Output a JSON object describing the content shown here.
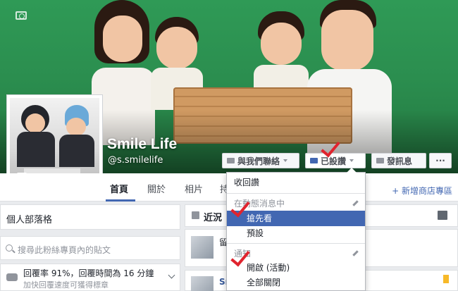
{
  "page": {
    "name": "Smile Life",
    "handle": "@s.smilelife"
  },
  "cover_buttons": {
    "contact": "與我們聯絡",
    "following": "已設讚",
    "message": "發訊息",
    "more": "···"
  },
  "nav": {
    "tabs": [
      "首頁",
      "關於",
      "相片",
      "持"
    ],
    "add_shop": "+ 新增商店專區"
  },
  "left": {
    "blog": "個人部落格",
    "search_placeholder": "搜尋此粉絲專頁內的貼文",
    "response_line1": "回覆率 91%，回覆時間為 16 分鐘",
    "response_line2": "加快回覆速度可獲得標章"
  },
  "right": {
    "recent": "近況",
    "post1_text": "留",
    "post2_text": "Sm"
  },
  "dropdown": {
    "unlike": "收回讚",
    "newsfeed_header": "在動態消息中",
    "see_first": "搶先看",
    "default": "預設",
    "notifications_header": "通知",
    "on": "開啟 (活動)",
    "all_off": "全部關閉"
  },
  "colors": {
    "accent": "#4267b2",
    "check_mark": "#e0242e",
    "cover_green": "#2f9a56"
  }
}
